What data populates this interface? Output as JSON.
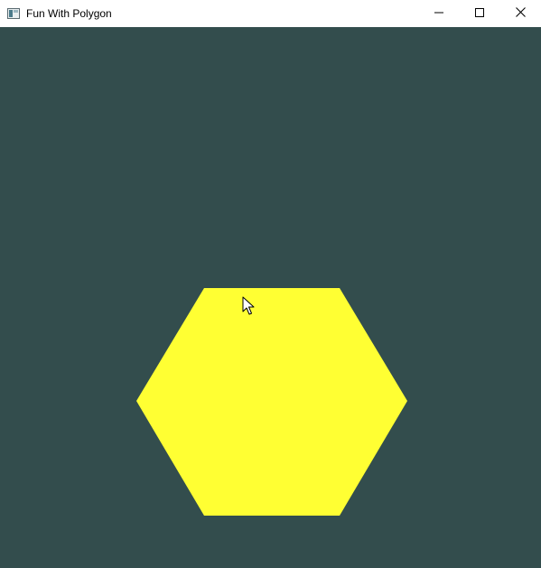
{
  "window": {
    "title": "Fun With Polygon",
    "app_icon": "window-app-icon",
    "controls": {
      "minimize": "minimize-icon",
      "maximize": "maximize-icon",
      "close": "close-icon"
    }
  },
  "scene": {
    "background_color": "#334d4d",
    "shape": "hexagon",
    "fill_color": "#ffff33"
  },
  "cursor": "mouse-pointer-icon"
}
